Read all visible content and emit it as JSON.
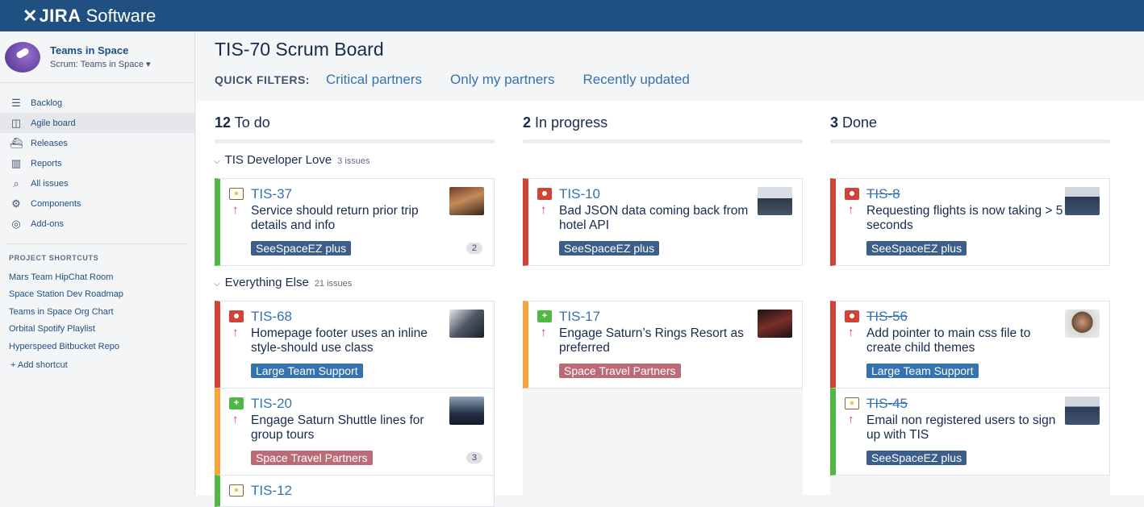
{
  "app": {
    "logo_mark": "✕",
    "brand": "JIRA",
    "product": "Software"
  },
  "project": {
    "name": "Teams in Space",
    "board_selector": "Scrum: Teams in Space ▾"
  },
  "nav": [
    {
      "label": "Backlog",
      "icon": "backlog-icon",
      "glyph": "☰"
    },
    {
      "label": "Agile board",
      "icon": "board-icon",
      "glyph": "◫"
    },
    {
      "label": "Releases",
      "icon": "releases-icon",
      "glyph": "⛴"
    },
    {
      "label": "Reports",
      "icon": "reports-icon",
      "glyph": "▥"
    },
    {
      "label": "All issues",
      "icon": "issues-icon",
      "glyph": "⌕"
    },
    {
      "label": "Components",
      "icon": "components-icon",
      "glyph": "⚙"
    },
    {
      "label": "Add-ons",
      "icon": "addons-icon",
      "glyph": "◎"
    }
  ],
  "shortcuts": {
    "title": "PROJECT SHORTCUTS",
    "items": [
      "Mars Team HipChat Room",
      "Space Station Dev Roadmap",
      "Teams in Space Org Chart",
      "Orbital Spotify Playlist",
      "Hyperspeed Bitbucket Repo"
    ],
    "add_label": "+ Add shortcut"
  },
  "board": {
    "title": "TIS-70 Scrum Board",
    "quick_filters_label": "QUICK FILTERS:",
    "quick_filters": [
      "Critical partners",
      "Only my partners",
      "Recently updated"
    ],
    "columns": [
      {
        "count": "12",
        "name": "To do"
      },
      {
        "count": "2",
        "name": "In progress"
      },
      {
        "count": "3",
        "name": "Done"
      }
    ],
    "swimlanes": [
      {
        "name": "TIS Developer Love",
        "count": "3 issues"
      },
      {
        "name": "Everything Else",
        "count": "21 issues"
      }
    ],
    "cards": [
      {
        "key": "TIS-37",
        "summary": "Service should return prior trip details and info",
        "epic": "SeeSpaceEZ plus",
        "estimate": "2",
        "type": "improvement",
        "priority": "high"
      },
      {
        "key": "TIS-10",
        "summary": "Bad JSON data coming back from hotel API",
        "epic": "SeeSpaceEZ plus",
        "type": "bug",
        "priority": "high"
      },
      {
        "key": "TIS-8",
        "summary": "Requesting flights is now taking > 5 seconds",
        "epic": "SeeSpaceEZ plus",
        "type": "bug",
        "priority": "high"
      },
      {
        "key": "TIS-68",
        "summary": "Homepage footer uses an inline style-should use class",
        "epic": "Large Team Support",
        "type": "bug",
        "priority": "high"
      },
      {
        "key": "TIS-17",
        "summary": "Engage Saturn’s Rings Resort as preferred",
        "epic": "Space Travel Partners",
        "type": "story",
        "priority": "high"
      },
      {
        "key": "TIS-56",
        "summary": "Add pointer to main css file to create child themes",
        "epic": "Large Team Support",
        "type": "bug",
        "priority": "high"
      },
      {
        "key": "TIS-20",
        "summary": "Engage Saturn Shuttle lines for group tours",
        "epic": "Space Travel Partners",
        "estimate": "3",
        "type": "story",
        "priority": "high"
      },
      {
        "key": "TIS-45",
        "summary": "Email non registered users to sign up with TIS",
        "epic": "SeeSpaceEZ plus",
        "type": "improvement",
        "priority": "high"
      },
      {
        "key": "TIS-12",
        "type": "improvement"
      }
    ]
  },
  "colors": {
    "header": "#205081",
    "link": "#3572b0",
    "bug": "#d04437",
    "story": "#51b846",
    "in_progress": "#f6a43b"
  }
}
